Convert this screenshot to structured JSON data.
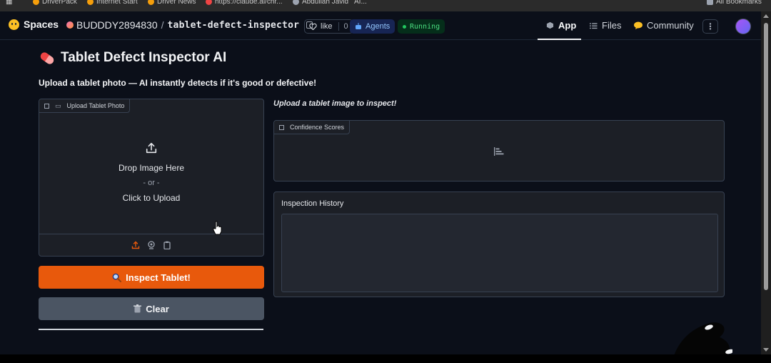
{
  "bookmarks": [
    "DriverPack",
    "Internet Start",
    "Driver News",
    "https://claude.ai/chr...",
    "Abdullah Javid",
    "AI...",
    "All Bookmarks"
  ],
  "header": {
    "spaces_label": "Spaces",
    "owner": "BUDDDY2894830",
    "space_name": "tablet-defect-inspector",
    "like_label": "like",
    "like_count": "0",
    "agents_label": "Agents",
    "status_label": "Running",
    "tabs": [
      {
        "label": "App",
        "active": true
      },
      {
        "label": "Files",
        "active": false
      },
      {
        "label": "Community",
        "active": false
      }
    ],
    "menu_label": "⋮"
  },
  "app": {
    "title": "Tablet Defect Inspector AI",
    "subtitle": "Upload a tablet photo — AI instantly detects if it's good or defective!",
    "upload": {
      "label": "Upload Tablet Photo",
      "drop_text": "Drop Image Here",
      "or_text": "- or -",
      "click_text": "Click to Upload"
    },
    "inspect_button": "Inspect Tablet!",
    "clear_button": "Clear",
    "result_text": "Upload a tablet image to inspect!",
    "scores_label": "Confidence Scores",
    "history_label": "Inspection History"
  },
  "colors": {
    "accent": "#e8590c",
    "background": "#0b0f19",
    "panel": "#1c1f26",
    "running": "#22c55e"
  }
}
